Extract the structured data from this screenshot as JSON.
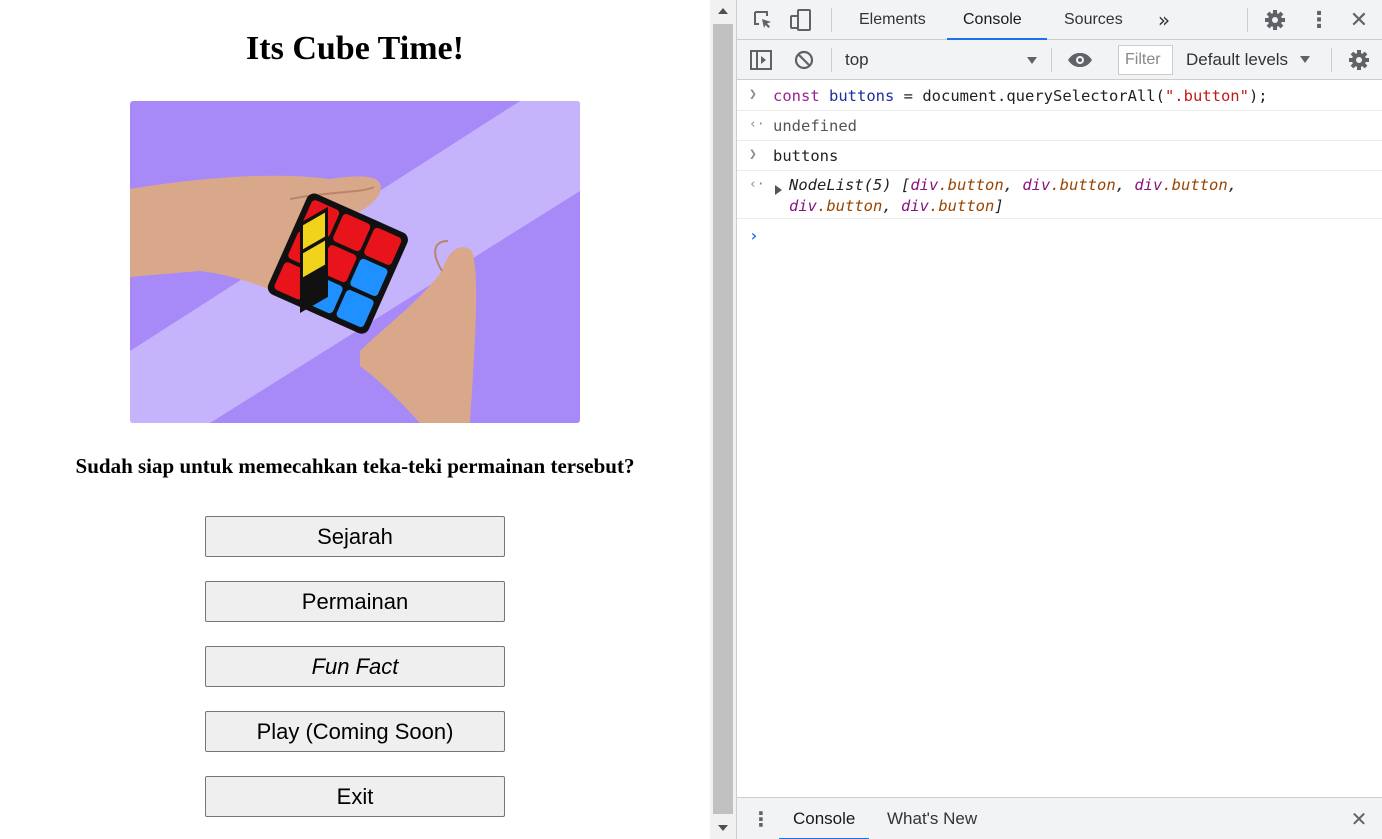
{
  "page": {
    "title": "Its Cube Time!",
    "question": "Sudah siap untuk memecahkan teka-teki permainan tersebut?",
    "buttons": [
      "Sejarah",
      "Permainan",
      "Fun Fact",
      "Play (Coming Soon)",
      "Exit"
    ],
    "colors": {
      "hero_bg": "#a78bfa",
      "hero_stripe": "#c4b5fd",
      "button_bg": "#efefef"
    }
  },
  "devtools": {
    "tabs": [
      "Elements",
      "Console",
      "Sources"
    ],
    "more_tabs_icon": "double-chevron-icon",
    "context": "top",
    "filter_placeholder": "Filter",
    "levels": "Default levels",
    "console": {
      "cmd1": {
        "kw": "const",
        "var": "buttons",
        "eq": " = document.querySelectorAll(",
        "arg": "\".button\"",
        "end": ");"
      },
      "result1": "undefined",
      "cmd2": "buttons",
      "result2": {
        "head": "NodeList(5)",
        "open": "[",
        "items": [
          "div",
          ".button"
        ],
        "close": "]"
      }
    },
    "drawer_tabs": [
      "Console",
      "What's New"
    ],
    "colors": {
      "accent": "#1a73e8",
      "toolbar": "#f1f3f4"
    }
  }
}
